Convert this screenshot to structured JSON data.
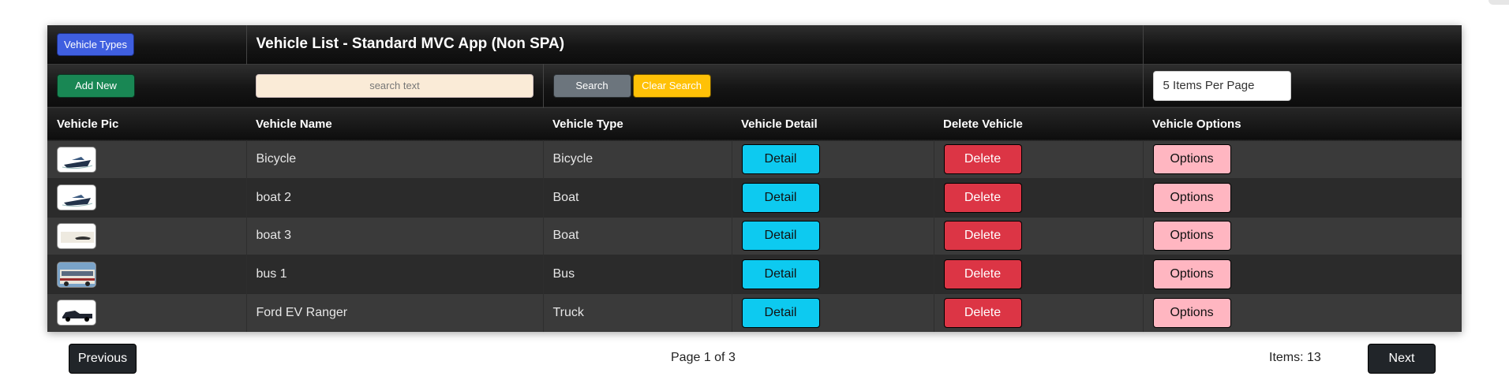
{
  "header": {
    "vehicle_types_label": "Vehicle Types",
    "title": "Vehicle List - Standard MVC App (Non SPA)"
  },
  "toolbar": {
    "add_new_label": "Add New",
    "search_placeholder": "search text",
    "search_value": "",
    "search_label": "Search",
    "clear_search_label": "Clear Search",
    "items_per_page": "5 Items Per Page"
  },
  "columns": [
    "Vehicle Pic",
    "Vehicle Name",
    "Vehicle Type",
    "Vehicle Detail",
    "Delete Vehicle",
    "Vehicle Options"
  ],
  "rows": [
    {
      "pic": "boat-thumbnail",
      "name": "Bicycle",
      "type": "Bicycle",
      "detail": "Detail",
      "delete": "Delete",
      "options": "Options"
    },
    {
      "pic": "boat-thumbnail",
      "name": "boat 2",
      "type": "Boat",
      "detail": "Detail",
      "delete": "Delete",
      "options": "Options"
    },
    {
      "pic": "white-boat-thumbnail",
      "name": "boat 3",
      "type": "Boat",
      "detail": "Detail",
      "delete": "Delete",
      "options": "Options"
    },
    {
      "pic": "bus-thumbnail",
      "name": "bus 1",
      "type": "Bus",
      "detail": "Detail",
      "delete": "Delete",
      "options": "Options"
    },
    {
      "pic": "truck-thumbnail",
      "name": "Ford EV Ranger",
      "type": "Truck",
      "detail": "Detail",
      "delete": "Delete",
      "options": "Options"
    }
  ],
  "pager": {
    "previous_label": "Previous",
    "page_info": "Page 1 of 3",
    "items_info": "Items: 13",
    "next_label": "Next"
  },
  "colors": {
    "vehicle_types": "#3f5fe0",
    "add_new": "#198754",
    "search": "#6c757d",
    "clear_search": "#ffc107",
    "detail": "#0dcaf0",
    "delete": "#dc3545",
    "options": "#ffb6c1",
    "nav": "#212529"
  }
}
